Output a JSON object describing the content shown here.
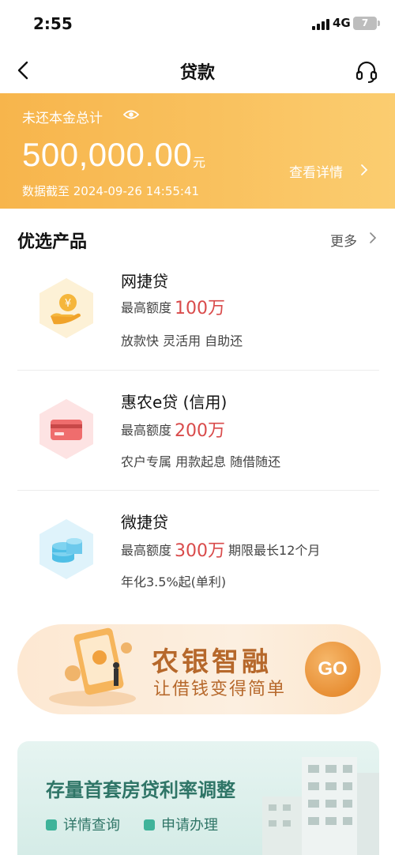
{
  "status_bar": {
    "time": "2:55",
    "network": "4G",
    "battery": "7"
  },
  "nav": {
    "title": "贷款",
    "back_icon": "chevron-left-icon",
    "support_icon": "headset-icon"
  },
  "balance": {
    "label": "未还本金总计",
    "amount": "500,000.00",
    "unit": "元",
    "detail_link": "查看详情",
    "data_time": "数据截至 2024-09-26 14:55:41",
    "color": "#f9c15e"
  },
  "featured": {
    "title": "优选产品",
    "more": "更多"
  },
  "products": [
    {
      "name": "网捷贷",
      "limit_label": "最高额度",
      "limit_value": "100万",
      "limit_extra": "",
      "tags": "放款快 灵活用 自助还",
      "icon": "hand-coin-icon"
    },
    {
      "name": "惠农e贷 (信用)",
      "limit_label": "最高额度",
      "limit_value": "200万",
      "limit_extra": "",
      "tags": "农户专属 用款起息 随借随还",
      "icon": "credit-card-icon"
    },
    {
      "name": "微捷贷",
      "limit_label": "最高额度",
      "limit_value": "300万",
      "limit_extra": "期限最长12个月",
      "tags": "年化3.5%起(单利)",
      "icon": "coin-stack-icon"
    }
  ],
  "promo": {
    "title": "农银智融",
    "subtitle": "让借钱变得简单",
    "button": "GO"
  },
  "mortgage": {
    "title": "存量首套房贷利率调整",
    "link1": "详情查询",
    "link2": "申请办理"
  }
}
